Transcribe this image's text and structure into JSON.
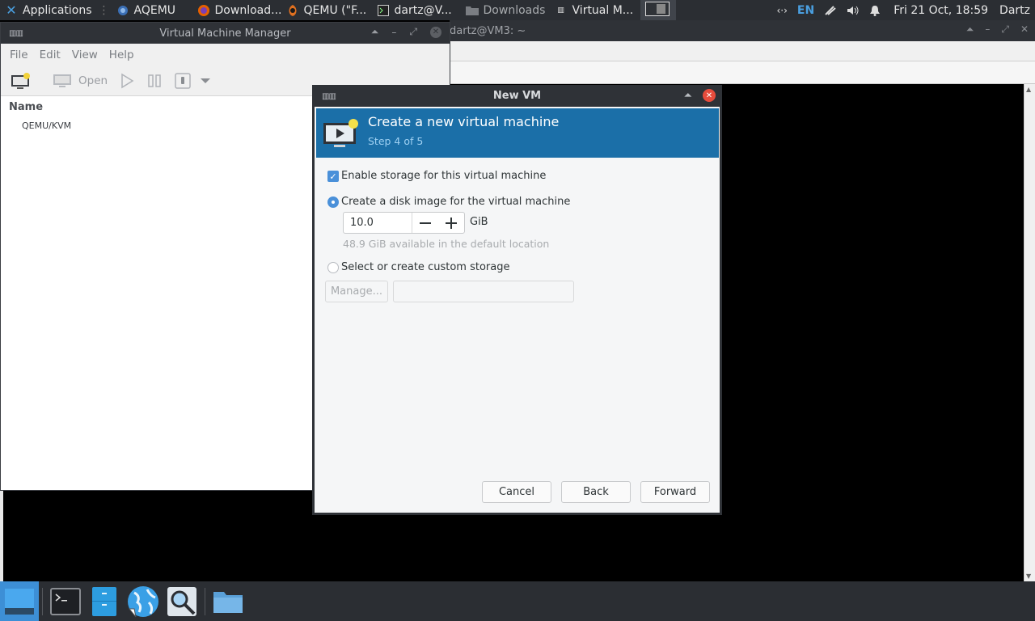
{
  "top_panel": {
    "applications": "Applications",
    "aqemu": "AQEMU",
    "firefox": "Download...",
    "qemu": "QEMU (\"F...",
    "terminal": "dartz@V...",
    "downloads": "Downloads",
    "virt_manager": "Virtual M...",
    "network_indicator": "‹·›",
    "language": "EN",
    "datetime": "Fri 21 Oct, 18:59",
    "user": "Dartz"
  },
  "terminal_window": {
    "title": "dartz@VM3: ~"
  },
  "vmm_window": {
    "title": "Virtual Machine Manager",
    "menu": [
      "File",
      "Edit",
      "View",
      "Help"
    ],
    "toolbar": {
      "open_label": "Open"
    },
    "list_header": "Name",
    "connection": "QEMU/KVM"
  },
  "new_vm_dialog": {
    "title": "New VM",
    "heading": "Create a new virtual machine",
    "step": "Step 4 of 5",
    "enable_storage_label": "Enable storage for this virtual machine",
    "enable_storage_checked": true,
    "create_disk_label": "Create a disk image for the virtual machine",
    "disk_size": "10.0",
    "disk_unit": "GiB",
    "available_hint": "48.9 GiB available in the default location",
    "custom_storage_label": "Select or create custom storage",
    "manage_label": "Manage...",
    "cancel_label": "Cancel",
    "back_label": "Back",
    "forward_label": "Forward"
  },
  "icons": {
    "dock": [
      "desktop-icon",
      "terminal-icon",
      "file-manager-icon",
      "web-browser-icon",
      "app-finder-icon",
      "folder-icon"
    ]
  },
  "colors": {
    "accent": "#4a90d9",
    "banner": "#1b6fa8",
    "panel": "#2b2e33",
    "close_red": "#e74c3c"
  }
}
